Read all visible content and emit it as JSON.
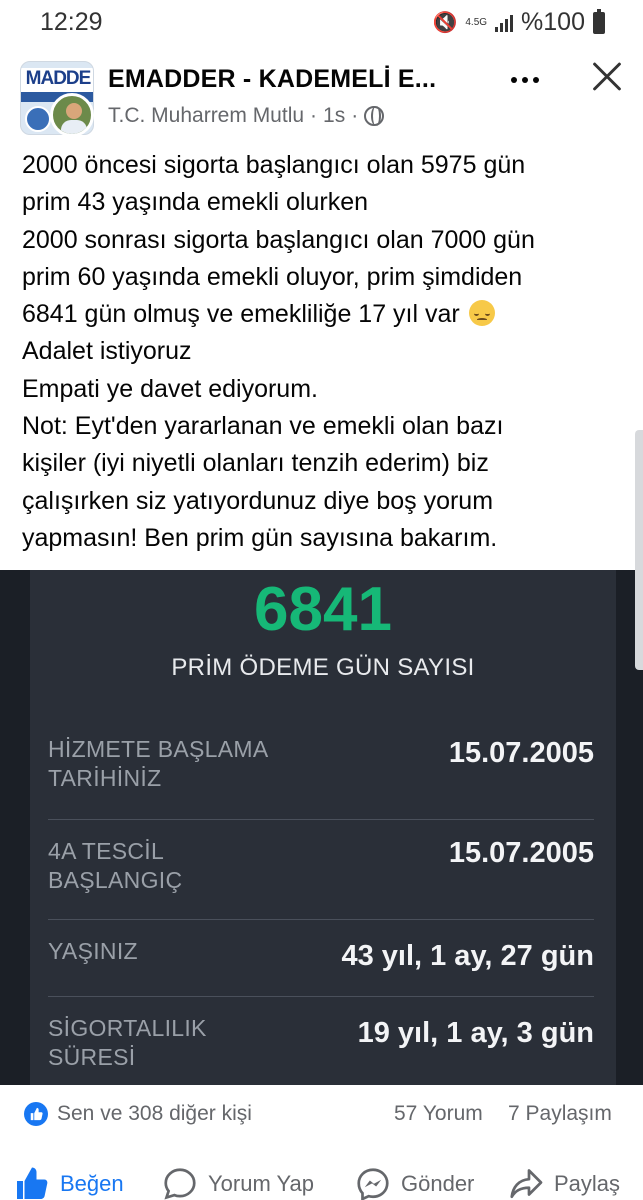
{
  "status_bar": {
    "time": "12:29",
    "network": "4.5G",
    "battery": "%100"
  },
  "post": {
    "group_name": "EMADDER - KADEMELİ E...",
    "author": "T.C. Muharrem Mutlu",
    "separator": "·",
    "time_ago": "1s",
    "avatar_logo_text": "MADDE",
    "text_lines": [
      "2000 öncesi sigorta başlangıcı olan 5975 gün",
      "prim 43 yaşında emekli olurken",
      "2000 sonrası sigorta başlangıcı olan 7000 gün",
      "prim 60 yaşında emekli oluyor, prim şimdiden",
      "6841 gün olmuş ve emekliliğe 17 yıl var",
      "Adalet istiyoruz",
      "Empati ye davet ediyorum.",
      "Not: Eyt'den yararlanan ve emekli olan bazı",
      "kişiler (iyi niyetli olanları tenzih ederim) biz",
      "çalışırken siz yatıyordunuz diye boş yorum",
      "yapmasın! Ben prim gün sayısına bakarım."
    ],
    "emoji": "pensive-face"
  },
  "embed": {
    "big_number": "6841",
    "caption": "PRİM ÖDEME GÜN SAYISI",
    "rows": [
      {
        "label_lines": [
          "HİZMETE BAŞLAMA",
          "TARİHİNİZ"
        ],
        "value": "15.07.2005"
      },
      {
        "label_lines": [
          "4A TESCİL",
          "BAŞLANGIÇ"
        ],
        "value": "15.07.2005"
      },
      {
        "label_lines": [
          "YAŞINIZ"
        ],
        "value": "43 yıl, 1 ay, 27 gün"
      },
      {
        "label_lines": [
          "SİGORTALILIK",
          "SÜRESİ"
        ],
        "value": "19 yıl, 1 ay, 3 gün"
      }
    ],
    "colors": {
      "number": "#16b877",
      "background": "#2a2f38"
    }
  },
  "reactions": {
    "text": "Sen ve 308 diğer kişi",
    "comments": "57 Yorum",
    "shares": "7 Paylaşım"
  },
  "actions": {
    "like": "Beğen",
    "comment": "Yorum Yap",
    "send": "Gönder",
    "share": "Paylaş"
  },
  "accent_color": "#1877f2"
}
